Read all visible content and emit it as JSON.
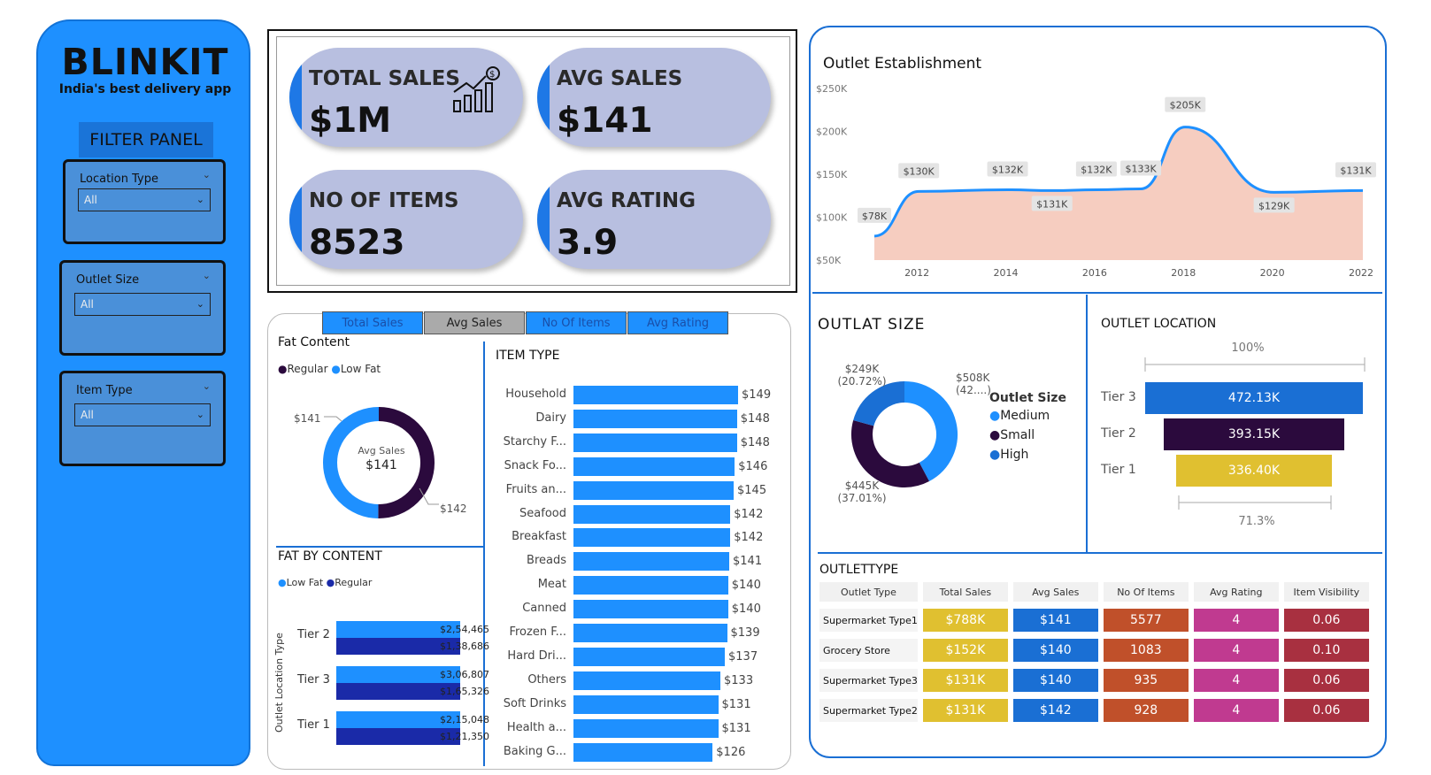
{
  "sidebar": {
    "brand": "BLINKIT",
    "tagline": "India's best delivery app",
    "filter_panel_title": "FILTER PANEL",
    "filters": [
      {
        "label": "Location Type",
        "value": "All"
      },
      {
        "label": "Outlet Size",
        "value": "All"
      },
      {
        "label": "Item Type",
        "value": "All"
      }
    ]
  },
  "kpis": [
    {
      "label": "TOTAL SALES",
      "value": "$1M",
      "icon": "sales-growth-icon"
    },
    {
      "label": "AVG SALES",
      "value": "$141"
    },
    {
      "label": "NO OF ITEMS",
      "value": "8523"
    },
    {
      "label": "AVG RATING",
      "value": "3.9"
    }
  ],
  "tabs": [
    "Total Sales",
    "Avg Sales",
    "No Of Items",
    "Avg Rating"
  ],
  "active_tab": "Avg Sales",
  "fat_content": {
    "title": "Fat Content",
    "legend": [
      "Regular",
      "Low Fat"
    ],
    "center_label": "Avg Sales",
    "center_value": "$141",
    "slices": [
      {
        "name": "Regular",
        "value": 142,
        "label": "$142",
        "color": "#2b0a3d"
      },
      {
        "name": "Low Fat",
        "value": 141,
        "label": "$141",
        "color": "#1E90FF"
      }
    ]
  },
  "fat_by_content": {
    "title": "FAT BY CONTENT",
    "legend": [
      "Low Fat",
      "Regular"
    ],
    "ylabel": "Outlet Location Type",
    "rows": [
      {
        "tier": "Tier 2",
        "low_fat": "$2,54,465",
        "regular": "$1,38,686"
      },
      {
        "tier": "Tier 3",
        "low_fat": "$3,06,807",
        "regular": "$1,65,326"
      },
      {
        "tier": "Tier 1",
        "low_fat": "$2,15,048",
        "regular": "$1,21,350"
      }
    ]
  },
  "item_type": {
    "title": "ITEM TYPE",
    "items": [
      {
        "name": "Household",
        "value": 149,
        "label": "$149"
      },
      {
        "name": "Dairy",
        "value": 148,
        "label": "$148"
      },
      {
        "name": "Starchy F...",
        "value": 148,
        "label": "$148"
      },
      {
        "name": "Snack Fo...",
        "value": 146,
        "label": "$146"
      },
      {
        "name": "Fruits an...",
        "value": 145,
        "label": "$145"
      },
      {
        "name": "Seafood",
        "value": 142,
        "label": "$142"
      },
      {
        "name": "Breakfast",
        "value": 142,
        "label": "$142"
      },
      {
        "name": "Breads",
        "value": 141,
        "label": "$141"
      },
      {
        "name": "Meat",
        "value": 140,
        "label": "$140"
      },
      {
        "name": "Canned",
        "value": 140,
        "label": "$140"
      },
      {
        "name": "Frozen F...",
        "value": 139,
        "label": "$139"
      },
      {
        "name": "Hard Dri...",
        "value": 137,
        "label": "$137"
      },
      {
        "name": "Others",
        "value": 133,
        "label": "$133"
      },
      {
        "name": "Soft Drinks",
        "value": 131,
        "label": "$131"
      },
      {
        "name": "Health a...",
        "value": 131,
        "label": "$131"
      },
      {
        "name": "Baking G...",
        "value": 126,
        "label": "$126"
      }
    ]
  },
  "chart_data": {
    "type": "area",
    "title": "Outlet Establishment",
    "x": [
      2011,
      2012,
      2014,
      2015,
      2016,
      2017,
      2018,
      2020,
      2022
    ],
    "y": [
      78,
      130,
      132,
      131,
      132,
      133,
      205,
      129,
      131
    ],
    "point_labels": [
      "$78K",
      "$130K",
      "$132K",
      "$131K",
      "$132K",
      "$133K",
      "$205K",
      "$129K",
      "$131K"
    ],
    "x_ticks": [
      "2012",
      "2014",
      "2016",
      "2018",
      "2020",
      "2022"
    ],
    "y_ticks": [
      "$50K",
      "$100K",
      "$150K",
      "$200K",
      "$250K"
    ],
    "ylim": [
      50,
      250
    ],
    "line_color": "#1E90FF",
    "fill_color": "#f6cdc0"
  },
  "outlet_size": {
    "title": "OUTLAT SIZE",
    "legend_title": "Outlet Size",
    "legend": [
      "Medium",
      "Small",
      "High"
    ],
    "labels": {
      "high_a": "$249K",
      "high_b": "(20.72%)",
      "medium_a": "$508K",
      "medium_b": "(42....)",
      "small_a": "$445K",
      "small_b": "(37.01%)"
    },
    "slices": [
      {
        "name": "Medium",
        "percent": 42.27,
        "color": "#1E90FF"
      },
      {
        "name": "Small",
        "percent": 37.01,
        "color": "#2b0a3d"
      },
      {
        "name": "High",
        "percent": 20.72,
        "color": "#1a6fd4"
      }
    ]
  },
  "outlet_location": {
    "title": "OUTLET LOCATION",
    "top_pct": "100%",
    "bottom_pct": "71.3%",
    "tiers": [
      {
        "name": "Tier 3",
        "value": 472.13,
        "label": "472.13K",
        "color": "#1a6fd4"
      },
      {
        "name": "Tier 2",
        "value": 393.15,
        "label": "393.15K",
        "color": "#2b0a3d"
      },
      {
        "name": "Tier 1",
        "value": 336.4,
        "label": "336.40K",
        "color": "#e0c030"
      }
    ]
  },
  "outlet_type": {
    "title": "OUTLETTYPE",
    "columns": [
      "Outlet Type",
      "Total Sales",
      "Avg Sales",
      "No Of Items",
      "Avg Rating",
      "Item Visibility"
    ],
    "rows": [
      [
        "Supermarket Type1",
        "$788K",
        "$141",
        "5577",
        "4",
        "0.06"
      ],
      [
        "Grocery Store",
        "$152K",
        "$140",
        "1083",
        "4",
        "0.10"
      ],
      [
        "Supermarket Type3",
        "$131K",
        "$140",
        "935",
        "4",
        "0.06"
      ],
      [
        "Supermarket Type2",
        "$131K",
        "$142",
        "928",
        "4",
        "0.06"
      ]
    ],
    "colors": [
      "#e0c030",
      "#1a6fd4",
      "#c0502a",
      "#c03a90",
      "#a83040"
    ]
  }
}
